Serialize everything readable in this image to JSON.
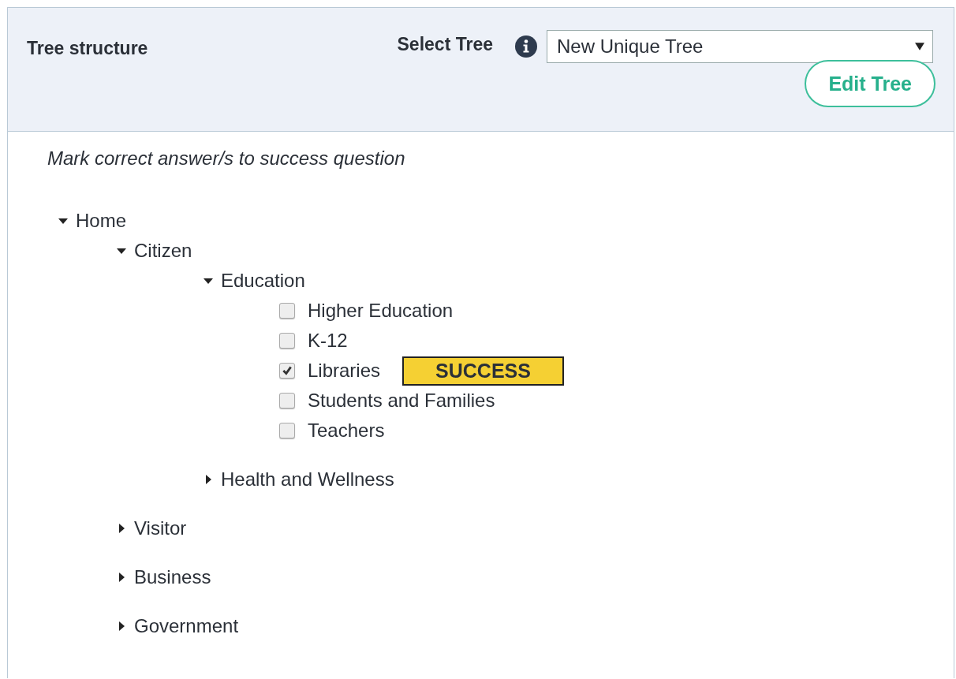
{
  "header": {
    "title": "Tree structure",
    "select_label": "Select Tree",
    "select": {
      "value": "New Unique Tree"
    },
    "edit_button": "Edit Tree"
  },
  "instruction": "Mark correct answer/s to success question",
  "tree": [
    {
      "kind": "branch",
      "label": "Home",
      "expanded": true,
      "children": [
        {
          "kind": "branch",
          "label": "Citizen",
          "expanded": true,
          "children": [
            {
              "kind": "branch",
              "label": "Education",
              "expanded": true,
              "children": [
                {
                  "kind": "checkbox",
                  "label": "Higher Education",
                  "checked": false
                },
                {
                  "kind": "checkbox",
                  "label": "K-12",
                  "checked": false
                },
                {
                  "kind": "checkbox",
                  "label": "Libraries",
                  "checked": true,
                  "badge": "SUCCESS"
                },
                {
                  "kind": "checkbox",
                  "label": "Students and Families",
                  "checked": false
                },
                {
                  "kind": "checkbox",
                  "label": "Teachers",
                  "checked": false
                }
              ]
            },
            {
              "kind": "branch",
              "label": "Health and Wellness",
              "expanded": false
            }
          ]
        },
        {
          "kind": "branch",
          "label": "Visitor",
          "expanded": false
        },
        {
          "kind": "branch",
          "label": "Business",
          "expanded": false
        },
        {
          "kind": "branch",
          "label": "Government",
          "expanded": false
        }
      ]
    }
  ]
}
